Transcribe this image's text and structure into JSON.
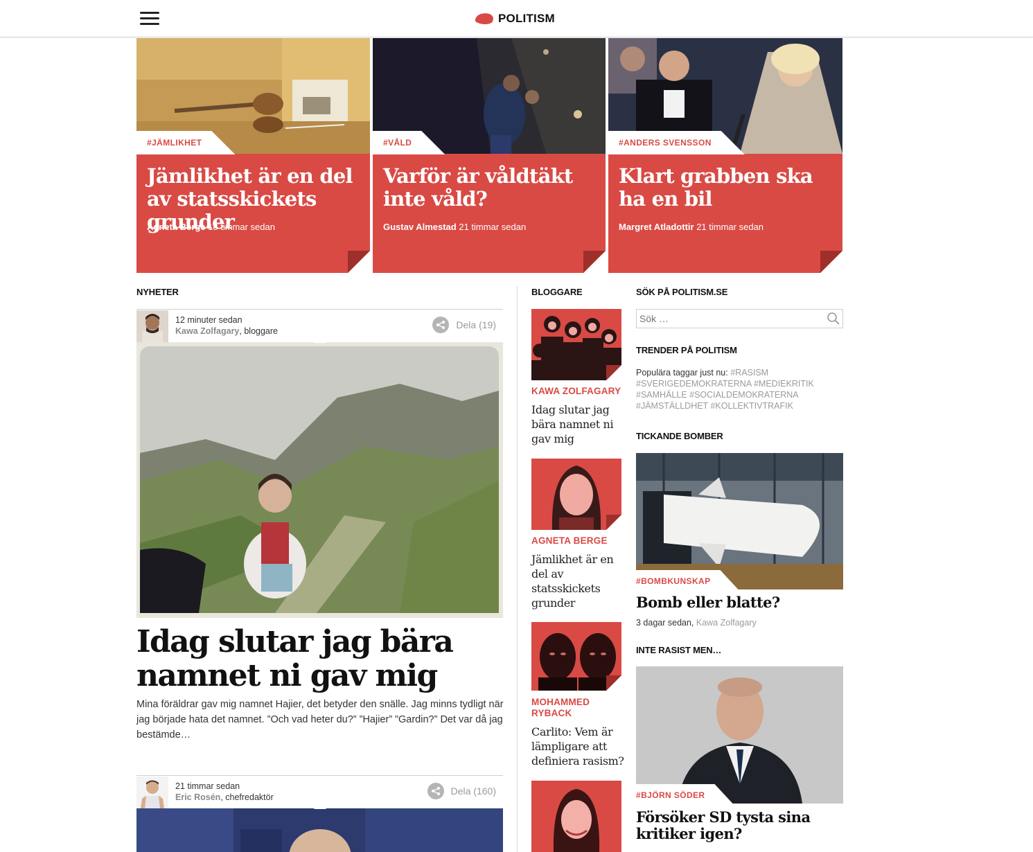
{
  "header": {
    "menu_icon": "hamburger-menu-icon",
    "logo_text": "POLITISM"
  },
  "colors": {
    "accent": "#d94a45",
    "muted": "#9a9a9a",
    "text": "#222222"
  },
  "featured": [
    {
      "tag": "#JÄMLIKHET",
      "title": "Jämlikhet är en del av statsskickets grunder",
      "author": "Agneta Berge",
      "time": "18 timmar sedan"
    },
    {
      "tag": "#VÅLD",
      "title": "Varför är våldtäkt inte våld?",
      "author": "Gustav Almestad",
      "time": "21 timmar sedan"
    },
    {
      "tag": "#ANDERS SVENSSON",
      "title": "Klart grabben ska ha en bil",
      "author": "Margret Atladottir",
      "time": "21 timmar sedan"
    }
  ],
  "news": {
    "section_title": "NYHETER",
    "posts": [
      {
        "time": "12 minuter sedan",
        "author": "Kawa Zolfagary",
        "role": ", bloggare",
        "share_label": "Dela (19)",
        "title": "Idag slutar jag bära namnet ni gav mig",
        "excerpt": "Mina föräldrar gav mig namnet Hajier, det betyder den snälle. Jag minns tydligt när jag började hata det namnet.  ”Och vad heter du?” ”Hajier” ”Gardin?” Det var då jag bestämde…"
      },
      {
        "time": "21 timmar sedan",
        "author": "Eric Rosén",
        "role": ", chefredaktör",
        "share_label": "Dela (160)"
      }
    ]
  },
  "bloggers": {
    "section_title": "BLOGGARE",
    "items": [
      {
        "name": "KAWA ZOLFAGARY",
        "post": "Idag slutar jag bära namnet ni gav mig"
      },
      {
        "name": "AGNETA BERGE",
        "post": "Jämlikhet är en del av statsskickets grunder"
      },
      {
        "name": "MOHAMMED RYBACK",
        "post": "Carlito: Vem är lämpligare att definiera rasism?"
      }
    ]
  },
  "sidebar": {
    "search_title": "SÖK PÅ POLITISM.SE",
    "search_placeholder": "Sök …",
    "trends_title": "TRENDER PÅ POLITISM",
    "trends_intro": "Populära taggar just nu:",
    "trend_tags": [
      "#RASISM",
      "#SVERIGEDEMOKRATERNA",
      "#MEDIEKRITIK",
      "#SAMHÄLLE",
      "#SOCIALDEMOKRATERNA",
      "#JÄMSTÄLLDHET",
      "#KOLLEKTIVTRAFIK"
    ],
    "bombs_title": "TICKANDE BOMBER",
    "bomb_tag": "#BOMBKUNSKAP",
    "bomb_post_title": "Bomb eller blatte?",
    "bomb_meta_time": "3 dagar sedan,",
    "bomb_meta_author": "Kawa Zolfagary",
    "racist_title": "INTE RASIST MEN…",
    "racist_tag": "#BJÖRN SÖDER",
    "racist_post_title": "Försöker SD tysta sina kritiker igen?"
  }
}
